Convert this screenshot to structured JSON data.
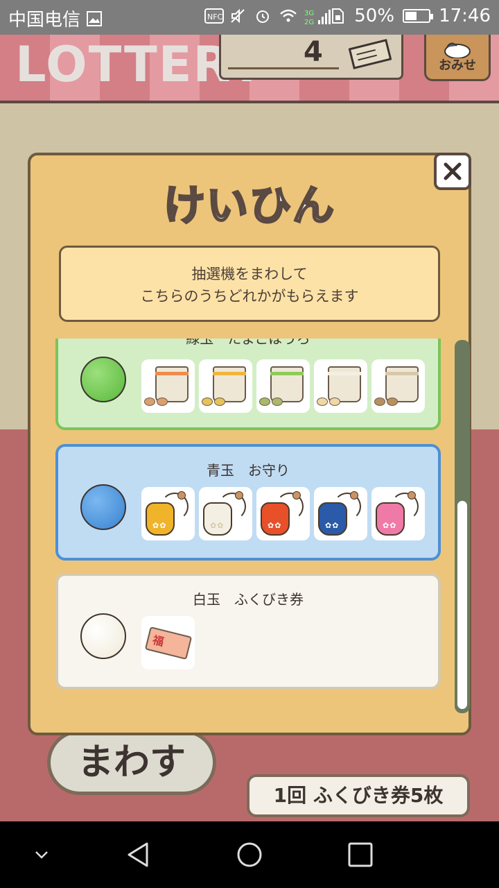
{
  "status_bar": {
    "carrier": "中国电信",
    "battery": "50%",
    "time": "17:46",
    "icons": [
      "image-icon",
      "nfc-icon",
      "mute-icon",
      "alarm-icon",
      "wifi-icon",
      "signal-icon",
      "sim-icon",
      "battery-icon"
    ]
  },
  "scene": {
    "sign": "LOTTERY",
    "ticket_count": "4",
    "shop_label": "おみせ",
    "spin_button": "まわす",
    "cost_label": "1回 ふくびき券5枚"
  },
  "modal": {
    "title": "けいひん",
    "description_line1": "抽選機をまわして",
    "description_line2": "こちらのうちどれかがもらえます",
    "close_icon": "close-icon",
    "prizes": [
      {
        "title": "緑玉　たまごぼうろ",
        "ball_color": "#6cc84c",
        "card_bg": "#d3eec5",
        "card_border": "#7cc35a",
        "item_count": 5,
        "item_icon": "egg-bag-icon"
      },
      {
        "title": "青玉　お守り",
        "ball_color": "#4a98e0",
        "card_bg": "#c0dcf3",
        "card_border": "#4d90d6",
        "item_count": 5,
        "item_icon": "omamori-icon"
      },
      {
        "title": "白玉　ふくびき券",
        "ball_color": "#f7f3e6",
        "card_bg": "#f8f5ee",
        "card_border": "#d3c9b0",
        "item_count": 1,
        "item_icon": "lottery-ticket-icon"
      }
    ]
  },
  "nav_bar": {
    "icons": [
      "chevron-down-icon",
      "back-icon",
      "home-icon",
      "recents-icon"
    ]
  }
}
